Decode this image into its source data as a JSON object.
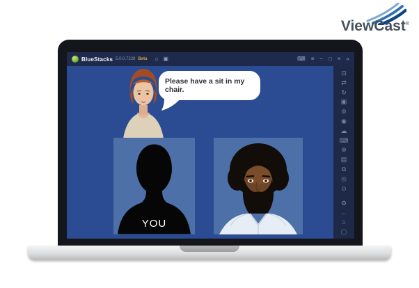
{
  "brand": {
    "name": "ViewCast",
    "registered_mark": "®",
    "text_color": "#46505c",
    "swoosh_colors": [
      "#7ea8cc",
      "#2f72b4",
      "#0c4486"
    ]
  },
  "laptop": {
    "window": {
      "titlebar": {
        "app_name": "BlueStacks",
        "version": "5.0.0.7228",
        "beta_label": "Beta",
        "left_icons": [
          {
            "name": "home-icon",
            "glyph": "⌂"
          },
          {
            "name": "tabs-icon",
            "glyph": "▣"
          }
        ],
        "right_icons": [
          {
            "name": "keyboard-icon",
            "glyph": "⌨"
          },
          {
            "name": "menu-icon",
            "glyph": "≡"
          },
          {
            "name": "minimize-icon",
            "glyph": "−"
          },
          {
            "name": "maximize-icon",
            "glyph": "□"
          },
          {
            "name": "close-icon",
            "glyph": "×"
          },
          {
            "name": "collapse-sidebar-icon",
            "glyph": "«"
          }
        ]
      },
      "sidebar": {
        "top_icons": [
          {
            "name": "fullscreen-icon",
            "glyph": "⊡"
          },
          {
            "name": "shake-icon",
            "glyph": "⇄"
          },
          {
            "name": "rotate-icon",
            "glyph": "↻"
          },
          {
            "name": "screenshot-icon",
            "glyph": "▣"
          },
          {
            "name": "camera-icon",
            "glyph": "⊚"
          },
          {
            "name": "screen-recorder-icon",
            "glyph": "◉"
          },
          {
            "name": "cloud-sync-icon",
            "glyph": "☁"
          },
          {
            "name": "game-controls-icon",
            "glyph": "⌨"
          },
          {
            "name": "aim-target-icon",
            "glyph": "⊕"
          },
          {
            "name": "media-manager-icon",
            "glyph": "▤"
          },
          {
            "name": "multi-instance-icon",
            "glyph": "⧉"
          },
          {
            "name": "macro-recorder-icon",
            "glyph": "◎"
          },
          {
            "name": "install-apk-icon",
            "glyph": "⊙"
          }
        ],
        "bottom_icons": [
          {
            "name": "settings-icon",
            "glyph": "⚙"
          },
          {
            "name": "back-icon",
            "glyph": "←"
          },
          {
            "name": "android-home-icon",
            "glyph": "⌂"
          },
          {
            "name": "recent-apps-icon",
            "glyph": "▢"
          }
        ]
      },
      "content": {
        "speech_bubble": {
          "text": "Please have a sit in my chair."
        },
        "you_panel": {
          "label": "YOU"
        },
        "avatars": {
          "woman": "red-haired woman avatar",
          "man": "bearded man avatar with afro",
          "you": "black silhouette placeholder"
        }
      }
    }
  },
  "colors": {
    "content_background": "#2b4c92",
    "panel_background": "#4c70a7",
    "titlebar_background": "#1e2a4c",
    "sidebar_background": "#1d2947",
    "bezel": "#14161c",
    "beta_accent": "#d9a441"
  }
}
